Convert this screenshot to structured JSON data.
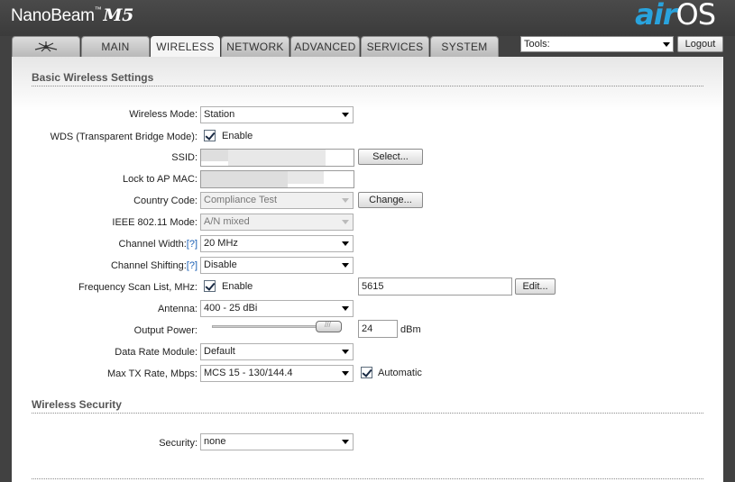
{
  "header": {
    "brand": "NanoBeam",
    "brand_tm": "™",
    "brand_model": "M5",
    "airos_logo": {
      "air": "air",
      "os": "OS"
    }
  },
  "tabs": [
    {
      "label": "",
      "icon": "ubiquiti-logo-icon"
    },
    {
      "label": "MAIN"
    },
    {
      "label": "WIRELESS",
      "active": true
    },
    {
      "label": "NETWORK"
    },
    {
      "label": "ADVANCED"
    },
    {
      "label": "SERVICES"
    },
    {
      "label": "SYSTEM"
    }
  ],
  "tools": {
    "label": "Tools:"
  },
  "logout": {
    "label": "Logout"
  },
  "basic": {
    "title": "Basic Wireless Settings",
    "wireless_mode": {
      "label": "Wireless Mode:",
      "value": "Station"
    },
    "wds": {
      "label": "WDS (Transparent Bridge Mode):",
      "checkbox": "Enable",
      "checked": true
    },
    "ssid": {
      "label": "SSID:",
      "button": "Select..."
    },
    "lock_ap": {
      "label": "Lock to AP MAC:"
    },
    "country": {
      "label": "Country Code:",
      "value": "Compliance Test",
      "button": "Change..."
    },
    "ieee": {
      "label": "IEEE 802.11 Mode:",
      "value": "A/N mixed"
    },
    "channel_width": {
      "label": "Channel Width:",
      "help": "[?]",
      "value": "20 MHz"
    },
    "channel_shifting": {
      "label": "Channel Shifting:",
      "help": "[?]",
      "value": "Disable"
    },
    "freq_scan": {
      "label": "Frequency Scan List, MHz:",
      "checkbox": "Enable",
      "checked": true,
      "value": "5615",
      "button": "Edit..."
    },
    "antenna": {
      "label": "Antenna:",
      "value": "400 - 25 dBi"
    },
    "output_power": {
      "label": "Output Power:",
      "value": "24",
      "unit": "dBm"
    },
    "data_rate": {
      "label": "Data Rate Module:",
      "value": "Default"
    },
    "max_tx": {
      "label": "Max TX Rate, Mbps:",
      "value": "MCS 15 - 130/144.4",
      "checkbox": "Automatic",
      "checked": true
    }
  },
  "security": {
    "title": "Wireless Security",
    "security": {
      "label": "Security:",
      "value": "none"
    }
  }
}
